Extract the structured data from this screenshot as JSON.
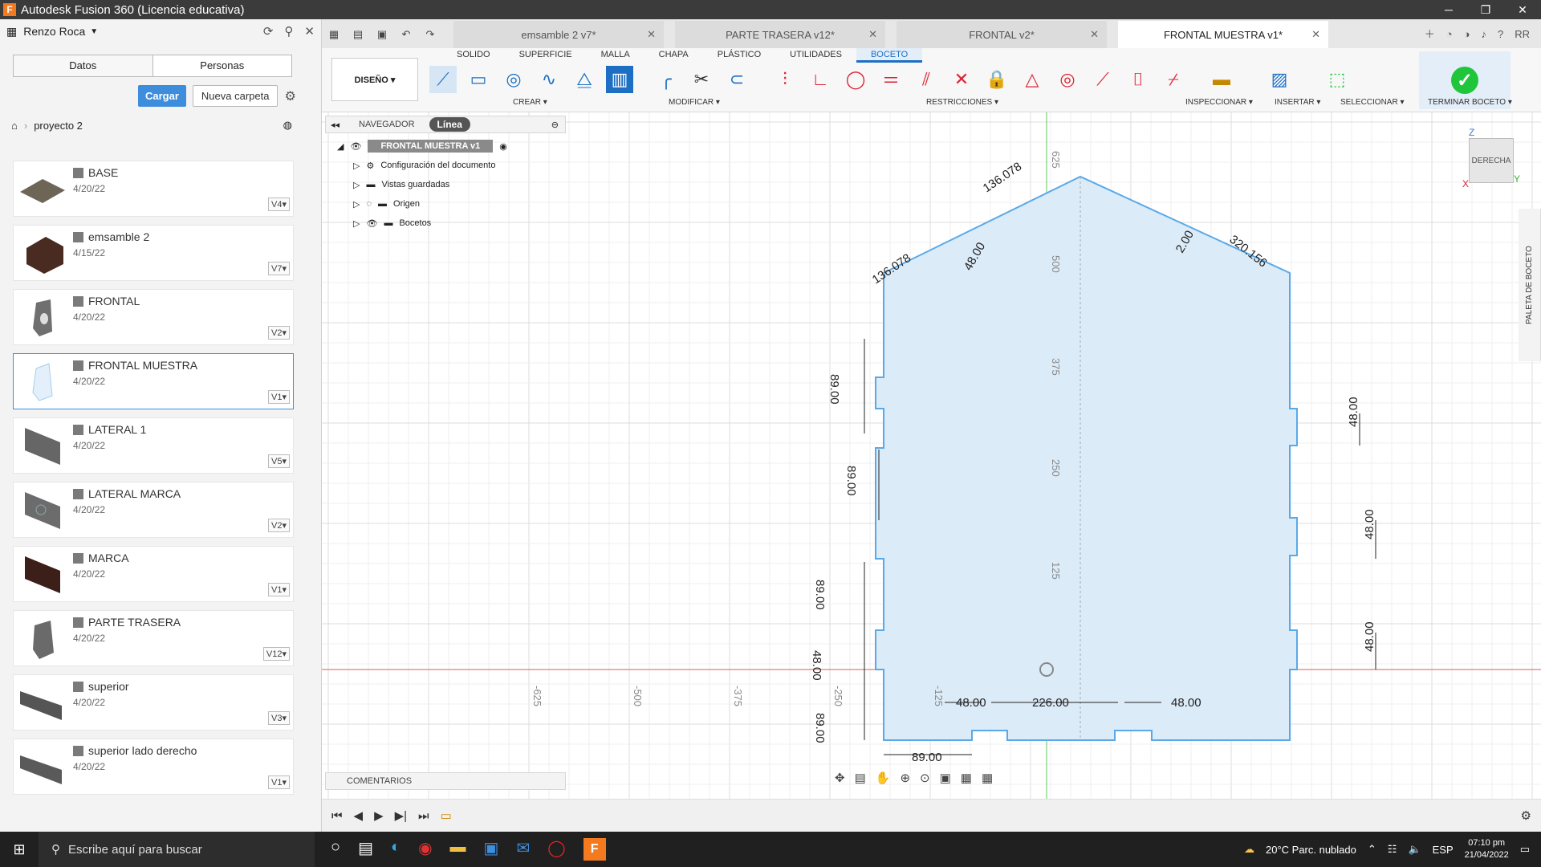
{
  "window": {
    "title": "Autodesk Fusion 360 (Licencia educativa)",
    "logo": "F"
  },
  "datapanel": {
    "user": "Renzo Roca",
    "tabs": [
      "Datos",
      "Personas"
    ],
    "upload_label": "Cargar",
    "new_folder_label": "Nueva carpeta",
    "breadcrumb": "proyecto 2",
    "files": [
      {
        "name": "BASE",
        "date": "4/20/22",
        "version": "V4"
      },
      {
        "name": "emsamble 2",
        "date": "4/15/22",
        "version": "V7"
      },
      {
        "name": "FRONTAL",
        "date": "4/20/22",
        "version": "V2"
      },
      {
        "name": "FRONTAL MUESTRA",
        "date": "4/20/22",
        "version": "V1"
      },
      {
        "name": "LATERAL 1",
        "date": "4/20/22",
        "version": "V5"
      },
      {
        "name": "LATERAL MARCA",
        "date": "4/20/22",
        "version": "V2"
      },
      {
        "name": "MARCA",
        "date": "4/20/22",
        "version": "V1"
      },
      {
        "name": "PARTE TRASERA",
        "date": "4/20/22",
        "version": "V12"
      },
      {
        "name": "superior",
        "date": "4/20/22",
        "version": "V3"
      },
      {
        "name": "superior lado derecho",
        "date": "4/20/22",
        "version": "V1"
      }
    ]
  },
  "doc_tabs": [
    "emsamble 2 v7*",
    "PARTE TRASERA v12*",
    "FRONTAL v2*",
    "FRONTAL MUESTRA v1*"
  ],
  "ribbon": {
    "workspace": "DISEÑO ▾",
    "tabs": [
      "SOLIDO",
      "SUPERFICIE",
      "MALLA",
      "CHAPA",
      "PLÁSTICO",
      "UTILIDADES",
      "BOCETO"
    ],
    "groups": {
      "crear": "CREAR ▾",
      "modificar": "MODIFICAR ▾",
      "restricciones": "RESTRICCIONES ▾",
      "inspeccionar": "INSPECCIONAR ▾",
      "insertar": "INSERTAR ▾",
      "seleccionar": "SELECCIONAR ▾",
      "terminar": "TERMINAR BOCETO ▾"
    }
  },
  "browser": {
    "label": "NAVEGADOR",
    "mode": "Línea",
    "root": "FRONTAL MUESTRA v1",
    "items": [
      "Configuración del documento",
      "Vistas guardadas",
      "Origen",
      "Bocetos"
    ],
    "comments": "COMENTARIOS"
  },
  "viewcube": {
    "face": "DERECHA",
    "z": "Z",
    "y": "Y",
    "x": "X"
  },
  "palette": "PALETA DE BOCETO",
  "sketch": {
    "axis_labels": [
      "-625",
      "-500",
      "-375",
      "-250",
      "-125",
      "125",
      "250",
      "375",
      "500",
      "625"
    ],
    "dimensions": [
      "136.078",
      "320.156",
      "136.078",
      "48.00",
      "2.00",
      "89.00",
      "89.00",
      "89.00",
      "48.00",
      "89.00",
      "48.00",
      "48.00",
      "48.00",
      "48.00",
      "226.00",
      "48.00",
      "89.00"
    ]
  },
  "taskbar": {
    "search_placeholder": "Escribe aquí para buscar",
    "weather": "20°C  Parc. nublado",
    "lang": "ESP",
    "time": "07:10 pm",
    "date": "21/04/2022"
  }
}
